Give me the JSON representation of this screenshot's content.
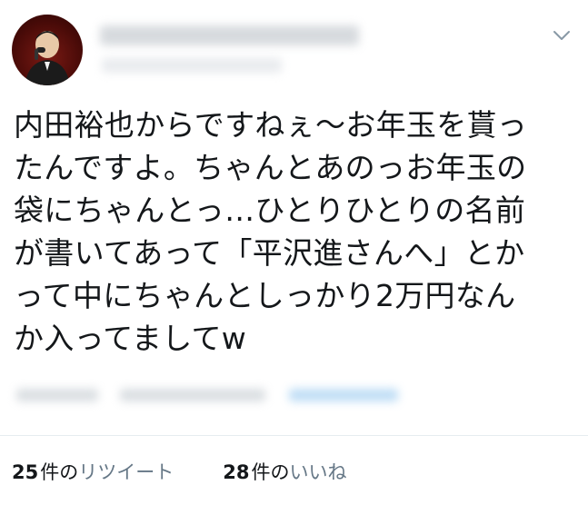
{
  "tweet": {
    "text_lines": [
      "内田裕也からですねぇ〜お年玉を貰っ",
      "たんですよ。ちゃんとあのっお年玉の",
      "袋にちゃんとっ…ひとりひとりの名前",
      "が書いてあって「平沢進さんへ」とか",
      "って中にちゃんとしっかり2万円なん",
      "か入ってましてw"
    ]
  },
  "stats": {
    "retweets": {
      "count": "25",
      "unit": "件の",
      "label": "リツイート"
    },
    "likes": {
      "count": "28",
      "unit": "件の",
      "label": "いいね"
    }
  },
  "icons": {
    "avatar": "profile-photo",
    "menu": "chevron-down-icon"
  },
  "colors": {
    "text": "#14171a",
    "secondary": "#657786",
    "divider": "#e6ecf0",
    "link_blur": "#a9d2f2"
  }
}
